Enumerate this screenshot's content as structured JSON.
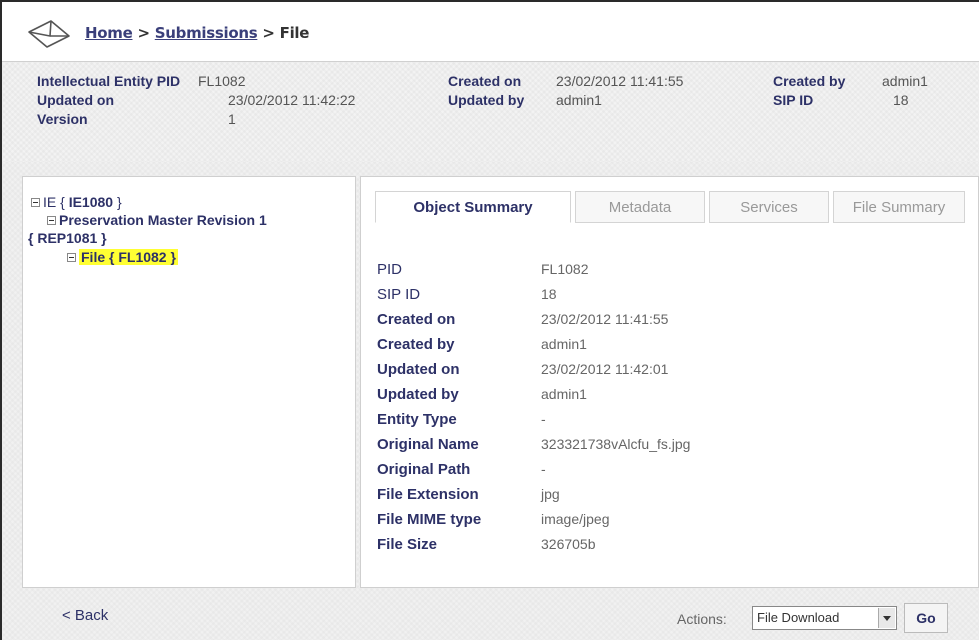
{
  "breadcrumb": {
    "home": "Home",
    "sep1": ">",
    "submissions": "Submissions",
    "sep2": ">",
    "current": "File"
  },
  "info": {
    "ie_pid_label": "Intellectual Entity PID",
    "ie_pid_value": "FL1082",
    "updated_on_label": "Updated on",
    "updated_on_value": "23/02/2012 11:42:22",
    "version_label": "Version",
    "version_value": "1",
    "created_on_label": "Created on",
    "created_on_value": "23/02/2012 11:41:55",
    "updated_by_label": "Updated by",
    "updated_by_value": "admin1",
    "created_by_label": "Created by",
    "created_by_value": "admin1",
    "sip_id_label": "SIP ID",
    "sip_id_value": "18"
  },
  "tree": {
    "ie_label": "IE { ",
    "ie_id": "IE1080",
    "ie_close": " }",
    "rep_label": "Preservation Master Revision 1",
    "rep_id": "{ REP1081 }",
    "file_label": "File { FL1082 }"
  },
  "tabs": [
    "Object Summary",
    "Metadata",
    "Services",
    "File Summary"
  ],
  "summary": {
    "rows": [
      {
        "label": "PID",
        "value": "FL1082"
      },
      {
        "label": "SIP ID",
        "value": "18"
      },
      {
        "label": "Created on",
        "value": "23/02/2012 11:41:55"
      },
      {
        "label": "Created by",
        "value": "admin1"
      },
      {
        "label": "Updated on",
        "value": "23/02/2012 11:42:01"
      },
      {
        "label": "Updated by",
        "value": "admin1"
      },
      {
        "label": "Entity Type",
        "value": "-"
      },
      {
        "label": "Original Name",
        "value": "323321738vAlcfu_fs.jpg"
      },
      {
        "label": "Original Path",
        "value": "-"
      },
      {
        "label": "File Extension",
        "value": "jpg"
      },
      {
        "label": "File MIME type",
        "value": "image/jpeg"
      },
      {
        "label": "File Size",
        "value": "326705b"
      }
    ]
  },
  "footer": {
    "back": "< Back",
    "actions_label": "Actions:",
    "action_selected": "File Download",
    "go": "Go"
  },
  "icons": {
    "header": "envelope-icon",
    "tree_toggle": "collapse-icon",
    "dropdown": "chevron-down-icon"
  },
  "colors": {
    "label": "#2d3167",
    "highlight": "#ffff33",
    "value": "#666666"
  }
}
